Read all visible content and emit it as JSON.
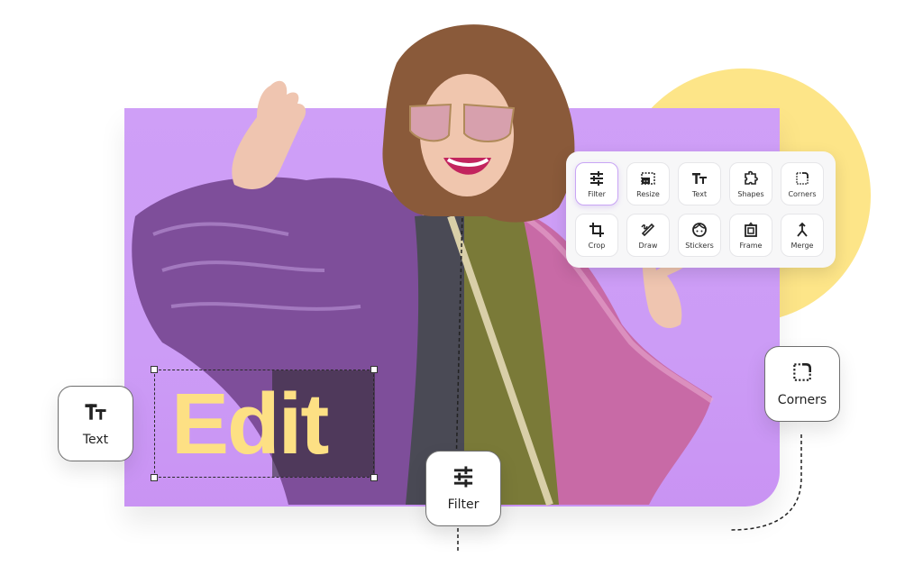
{
  "canvas": {
    "edit_text": "Edit",
    "colors": {
      "panel_purple": "#cf9ff7",
      "circle_yellow": "#fde588",
      "edit_text_yellow": "#fde084",
      "active_tool_border": "#c9a5f5"
    }
  },
  "toolbar": {
    "tools": [
      {
        "label": "Filter",
        "icon": "sliders-icon",
        "active": true
      },
      {
        "label": "Resize",
        "icon": "resize-icon",
        "active": false
      },
      {
        "label": "Text",
        "icon": "text-icon",
        "active": false
      },
      {
        "label": "Shapes",
        "icon": "puzzle-shape-icon",
        "active": false
      },
      {
        "label": "Corners",
        "icon": "corners-icon",
        "active": false
      },
      {
        "label": "Crop",
        "icon": "crop-icon",
        "active": false
      },
      {
        "label": "Draw",
        "icon": "pencil-draw-icon",
        "active": false
      },
      {
        "label": "Stickers",
        "icon": "face-sticker-icon",
        "active": false
      },
      {
        "label": "Frame",
        "icon": "frame-icon",
        "active": false
      },
      {
        "label": "Merge",
        "icon": "merge-icon",
        "active": false
      }
    ]
  },
  "cards": {
    "text": {
      "label": "Text",
      "icon": "text-icon"
    },
    "filter": {
      "label": "Filter",
      "icon": "sliders-icon"
    },
    "corners": {
      "label": "Corners",
      "icon": "corners-icon"
    }
  }
}
